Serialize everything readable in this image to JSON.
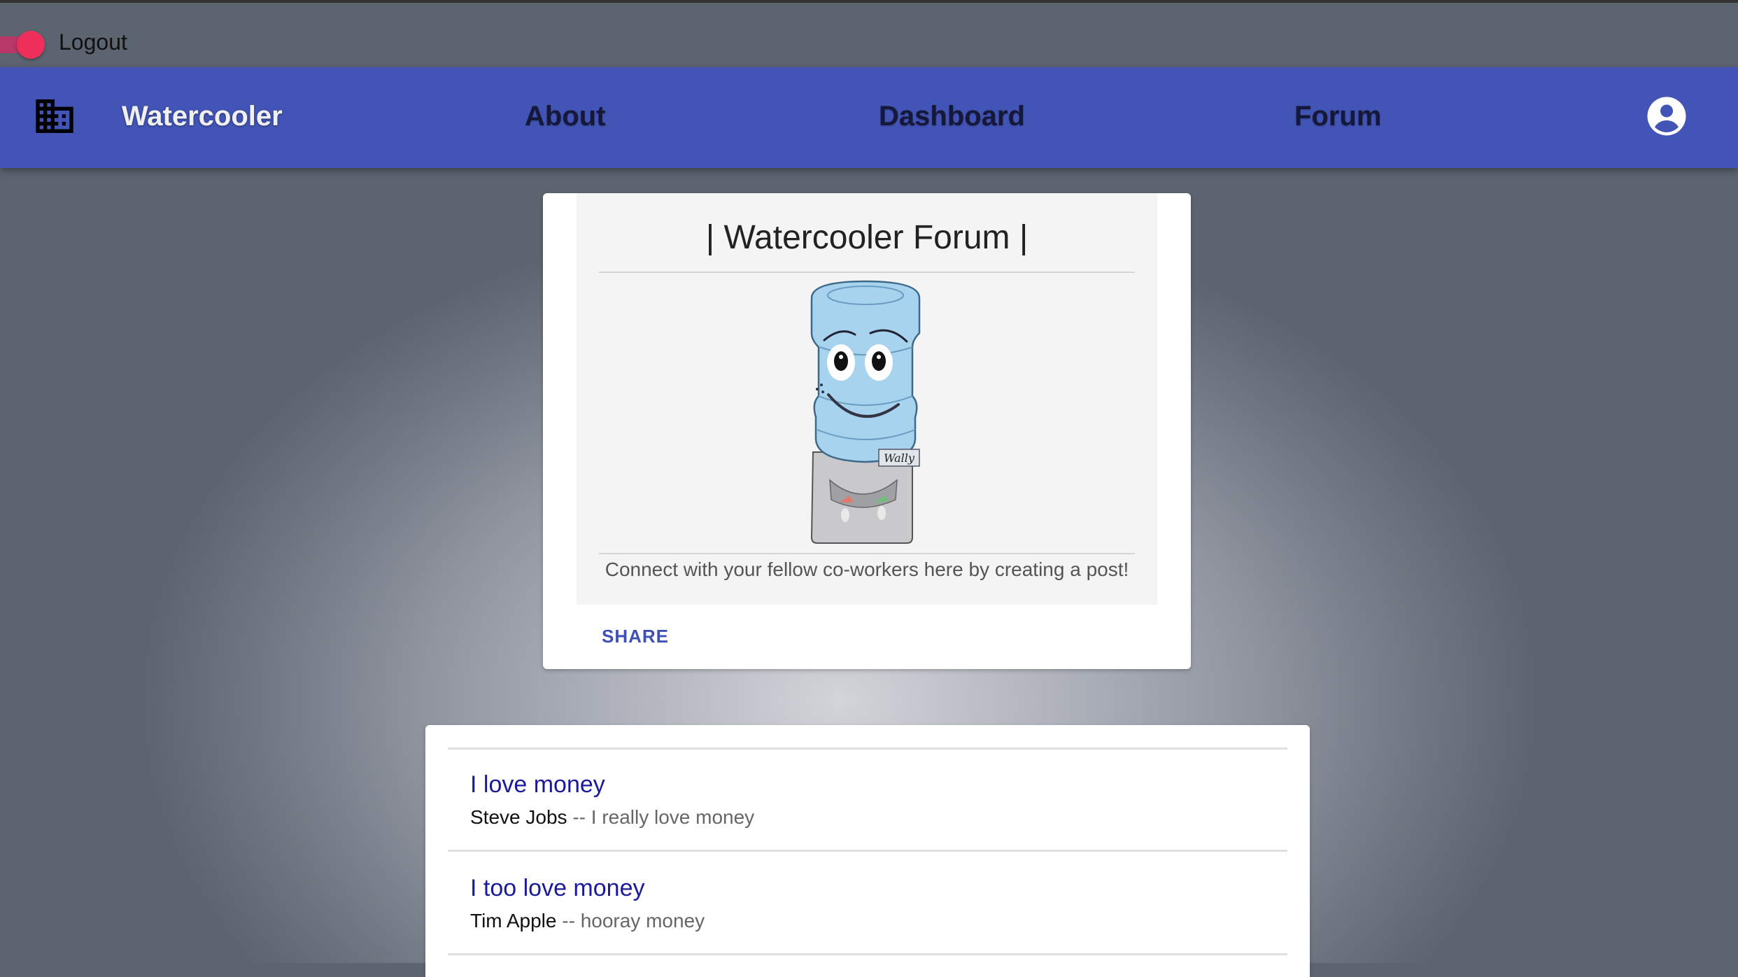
{
  "topbar": {
    "toggle_state": "on",
    "logout_label": "Logout"
  },
  "appbar": {
    "brand": "Watercooler",
    "logo_icon": "building-icon",
    "nav": [
      {
        "label": "About"
      },
      {
        "label": "Dashboard"
      },
      {
        "label": "Forum"
      }
    ],
    "account_icon": "account-circle-icon"
  },
  "hero": {
    "title": "| Watercooler Forum |",
    "mascot_tag": "Wally",
    "caption": "Connect with your fellow co-workers here by creating a post!",
    "share_label": "SHARE"
  },
  "posts": [
    {
      "title": "I love money",
      "author": "Steve Jobs",
      "separator": "--",
      "body": "I really love money"
    },
    {
      "title": "I too love money",
      "author": "Tim Apple",
      "separator": "--",
      "body": "hooray money"
    }
  ],
  "colors": {
    "appbar": "#4254b5",
    "toggle": "#ef2f5b",
    "link": "#1a1a9a",
    "accent": "#3f51b5"
  }
}
